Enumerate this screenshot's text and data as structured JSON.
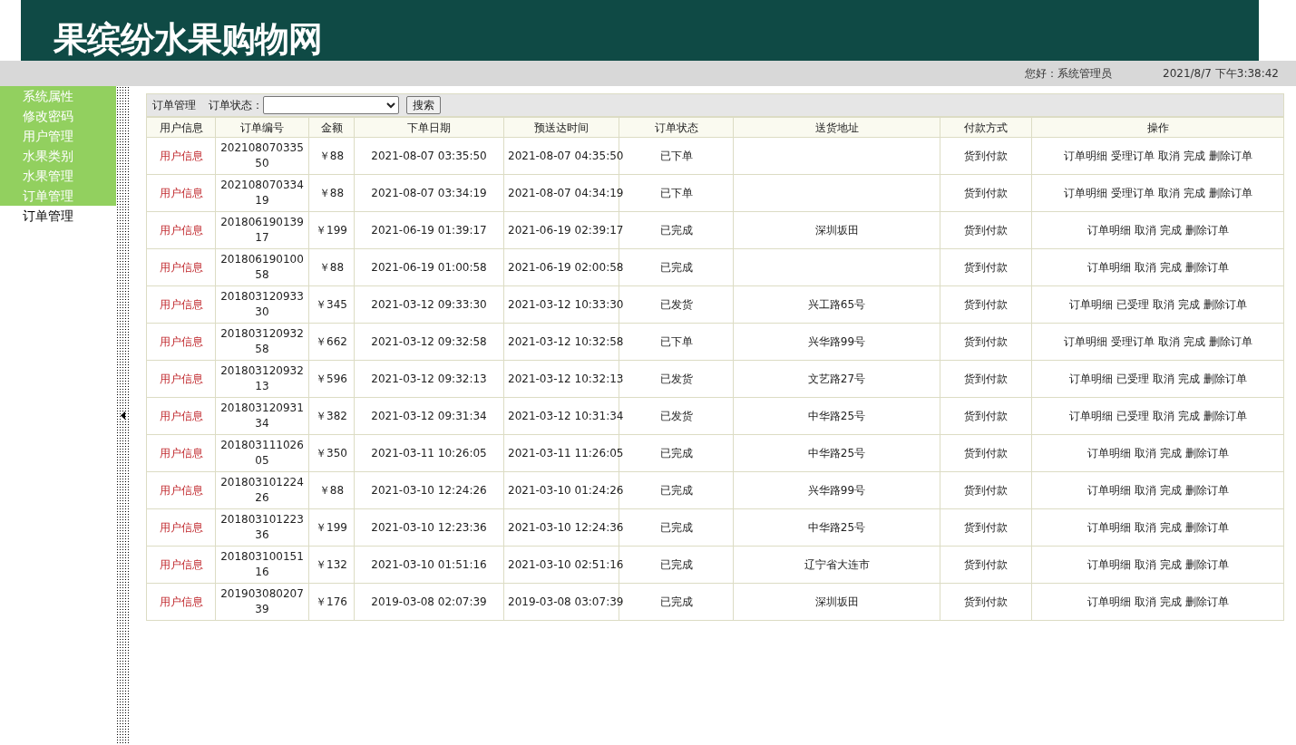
{
  "header": {
    "title": "果缤纷水果购物网"
  },
  "status_bar": {
    "greeting": "您好：系统管理员",
    "datetime": "2021/8/7 下午3:38:42"
  },
  "sidebar": {
    "items": [
      {
        "label": "系统属性"
      },
      {
        "label": "修改密码"
      },
      {
        "label": "用户管理"
      },
      {
        "label": "水果类别"
      },
      {
        "label": "水果管理"
      },
      {
        "label": "订单管理",
        "children": [
          {
            "label": "订单管理"
          }
        ]
      }
    ]
  },
  "toolbar": {
    "title": "订单管理",
    "filter_label": "订单状态：",
    "search_button": "搜索"
  },
  "table": {
    "columns": [
      "用户信息",
      "订单编号",
      "金额",
      "下单日期",
      "预送达时间",
      "订单状态",
      "送货地址",
      "付款方式",
      "操作"
    ],
    "rows": [
      {
        "user": "用户信息",
        "order_no": "20210807033550",
        "amount": "￥88",
        "order_date": "2021-08-07 03:35:50",
        "delivery_time": "2021-08-07 04:35:50",
        "status": "已下单",
        "address": "",
        "payment": "货到付款",
        "actions": [
          "订单明细",
          "受理订单",
          "取消",
          "完成",
          "删除订单"
        ]
      },
      {
        "user": "用户信息",
        "order_no": "20210807033419",
        "amount": "￥88",
        "order_date": "2021-08-07 03:34:19",
        "delivery_time": "2021-08-07 04:34:19",
        "status": "已下单",
        "address": "",
        "payment": "货到付款",
        "actions": [
          "订单明细",
          "受理订单",
          "取消",
          "完成",
          "删除订单"
        ]
      },
      {
        "user": "用户信息",
        "order_no": "20180619013917",
        "amount": "￥199",
        "order_date": "2021-06-19 01:39:17",
        "delivery_time": "2021-06-19 02:39:17",
        "status": "已完成",
        "address": "深圳坂田",
        "payment": "货到付款",
        "actions": [
          "订单明细",
          "取消",
          "完成",
          "删除订单"
        ]
      },
      {
        "user": "用户信息",
        "order_no": "20180619010058",
        "amount": "￥88",
        "order_date": "2021-06-19 01:00:58",
        "delivery_time": "2021-06-19 02:00:58",
        "status": "已完成",
        "address": "",
        "payment": "货到付款",
        "actions": [
          "订单明细",
          "取消",
          "完成",
          "删除订单"
        ]
      },
      {
        "user": "用户信息",
        "order_no": "20180312093330",
        "amount": "￥345",
        "order_date": "2021-03-12 09:33:30",
        "delivery_time": "2021-03-12 10:33:30",
        "status": "已发货",
        "address": "兴工路65号",
        "payment": "货到付款",
        "actions": [
          "订单明细",
          "已受理",
          "取消",
          "完成",
          "删除订单"
        ]
      },
      {
        "user": "用户信息",
        "order_no": "20180312093258",
        "amount": "￥662",
        "order_date": "2021-03-12 09:32:58",
        "delivery_time": "2021-03-12 10:32:58",
        "status": "已下单",
        "address": "兴华路99号",
        "payment": "货到付款",
        "actions": [
          "订单明细",
          "受理订单",
          "取消",
          "完成",
          "删除订单"
        ]
      },
      {
        "user": "用户信息",
        "order_no": "20180312093213",
        "amount": "￥596",
        "order_date": "2021-03-12 09:32:13",
        "delivery_time": "2021-03-12 10:32:13",
        "status": "已发货",
        "address": "文艺路27号",
        "payment": "货到付款",
        "actions": [
          "订单明细",
          "已受理",
          "取消",
          "完成",
          "删除订单"
        ]
      },
      {
        "user": "用户信息",
        "order_no": "20180312093134",
        "amount": "￥382",
        "order_date": "2021-03-12 09:31:34",
        "delivery_time": "2021-03-12 10:31:34",
        "status": "已发货",
        "address": "中华路25号",
        "payment": "货到付款",
        "actions": [
          "订单明细",
          "已受理",
          "取消",
          "完成",
          "删除订单"
        ]
      },
      {
        "user": "用户信息",
        "order_no": "20180311102605",
        "amount": "￥350",
        "order_date": "2021-03-11 10:26:05",
        "delivery_time": "2021-03-11 11:26:05",
        "status": "已完成",
        "address": "中华路25号",
        "payment": "货到付款",
        "actions": [
          "订单明细",
          "取消",
          "完成",
          "删除订单"
        ]
      },
      {
        "user": "用户信息",
        "order_no": "20180310122426",
        "amount": "￥88",
        "order_date": "2021-03-10 12:24:26",
        "delivery_time": "2021-03-10 01:24:26",
        "status": "已完成",
        "address": "兴华路99号",
        "payment": "货到付款",
        "actions": [
          "订单明细",
          "取消",
          "完成",
          "删除订单"
        ]
      },
      {
        "user": "用户信息",
        "order_no": "20180310122336",
        "amount": "￥199",
        "order_date": "2021-03-10 12:23:36",
        "delivery_time": "2021-03-10 12:24:36",
        "status": "已完成",
        "address": "中华路25号",
        "payment": "货到付款",
        "actions": [
          "订单明细",
          "取消",
          "完成",
          "删除订单"
        ]
      },
      {
        "user": "用户信息",
        "order_no": "20180310015116",
        "amount": "￥132",
        "order_date": "2021-03-10 01:51:16",
        "delivery_time": "2021-03-10 02:51:16",
        "status": "已完成",
        "address": "辽宁省大连市",
        "payment": "货到付款",
        "actions": [
          "订单明细",
          "取消",
          "完成",
          "删除订单"
        ]
      },
      {
        "user": "用户信息",
        "order_no": "20190308020739",
        "amount": "￥176",
        "order_date": "2019-03-08 02:07:39",
        "delivery_time": "2019-03-08 03:07:39",
        "status": "已完成",
        "address": "深圳坂田",
        "payment": "货到付款",
        "actions": [
          "订单明细",
          "取消",
          "完成",
          "删除订单"
        ]
      }
    ]
  }
}
